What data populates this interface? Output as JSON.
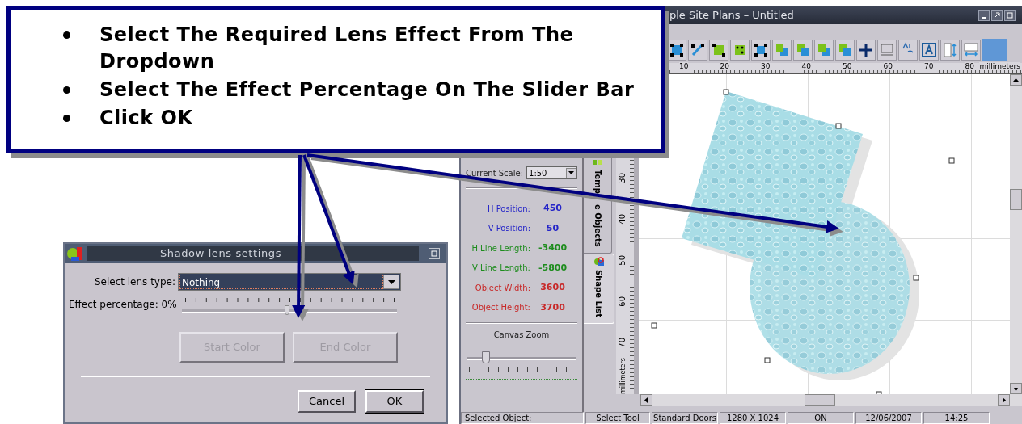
{
  "callout": {
    "bullets": [
      "Select The Required Lens Effect From The Dropdown",
      "Select The Effect Percentage On The Slider Bar",
      "Click OK"
    ]
  },
  "app": {
    "title": "ple Site Plans – Untitled",
    "ruler_h": {
      "labels": [
        "10",
        "20",
        "30",
        "40",
        "50",
        "60",
        "70",
        "80"
      ],
      "unit": "millimeters"
    },
    "ruler_v": {
      "labels": [
        "30",
        "40",
        "50",
        "60",
        "70"
      ],
      "unit": "millimeters"
    },
    "panel": {
      "scale_label": "Current Scale:",
      "scale_value": "1:50",
      "fields": [
        {
          "label": "H Position:",
          "value": "450",
          "color": "#2424c8"
        },
        {
          "label": "V Position:",
          "value": "50",
          "color": "#2424c8"
        },
        {
          "label": "H Line Length:",
          "value": "-3400",
          "color": "#1e8c1e"
        },
        {
          "label": "V Line Length:",
          "value": "-5800",
          "color": "#1e8c1e"
        },
        {
          "label": "Object Width:",
          "value": "3600",
          "color": "#c82828"
        },
        {
          "label": "Object Height:",
          "value": "3700",
          "color": "#c82828"
        }
      ],
      "zoom_label": "Canvas Zoom",
      "zoom": {
        "level": 0.17
      }
    },
    "tabs": [
      {
        "label_parts": [
          "Temp",
          "e Objects"
        ],
        "selected": false
      },
      {
        "label_parts": [
          "Shape List"
        ],
        "selected": true
      }
    ],
    "status_bar": [
      "Selected Object:",
      "Select Tool",
      "Standard Doors",
      "1280 X 1024",
      "ON",
      "12/06/2007",
      "14:25"
    ]
  },
  "dialog": {
    "title": "Shadow lens settings",
    "lens_label": "Select lens type:",
    "lens_value": "Nothing",
    "effect_label": "Effect percentage: 0%",
    "effect": {
      "level": 0.49
    },
    "buttons": [
      {
        "label": "Start Color",
        "disabled": true
      },
      {
        "label": "End Color",
        "disabled": true
      },
      {
        "label": "Cancel",
        "disabled": false,
        "default": false
      },
      {
        "label": "OK",
        "disabled": false,
        "default": true
      }
    ]
  }
}
